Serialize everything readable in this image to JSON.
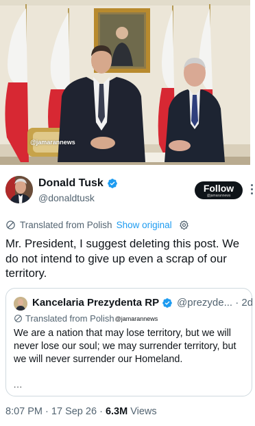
{
  "photo": {
    "watermark": "@jamarannews"
  },
  "author": {
    "name": "Donald Tusk",
    "handle": "@donaldtusk",
    "verified_color": "#1d9bf0"
  },
  "follow_button": {
    "label": "Follow",
    "watermark": "@jamarannews"
  },
  "translation": {
    "label": "Translated from Polish",
    "show_original": "Show original"
  },
  "tweet": {
    "text": "Mr. President, I suggest deleting this post. We do not intend to give up even a scrap of our territory."
  },
  "quote": {
    "name": "Kancelaria Prezydenta RP",
    "handle": "@prezyde... · 2d",
    "translation_label": "Translated from Polish",
    "watermark": "@jamarannews",
    "text": "We are a nation that may lose territory, but we will never lose our soul; we may surrender territory, but we will never surrender our Homeland.",
    "more": "..."
  },
  "meta": {
    "time": "8:07 PM",
    "separator": "·",
    "date": "17 Sep 26",
    "views_count": "6.3M",
    "views_label": "Views"
  },
  "icons": {
    "translate": "translate-icon",
    "settings": "gear-icon",
    "verified": "verified-badge-icon",
    "more": "more-menu-icon"
  }
}
